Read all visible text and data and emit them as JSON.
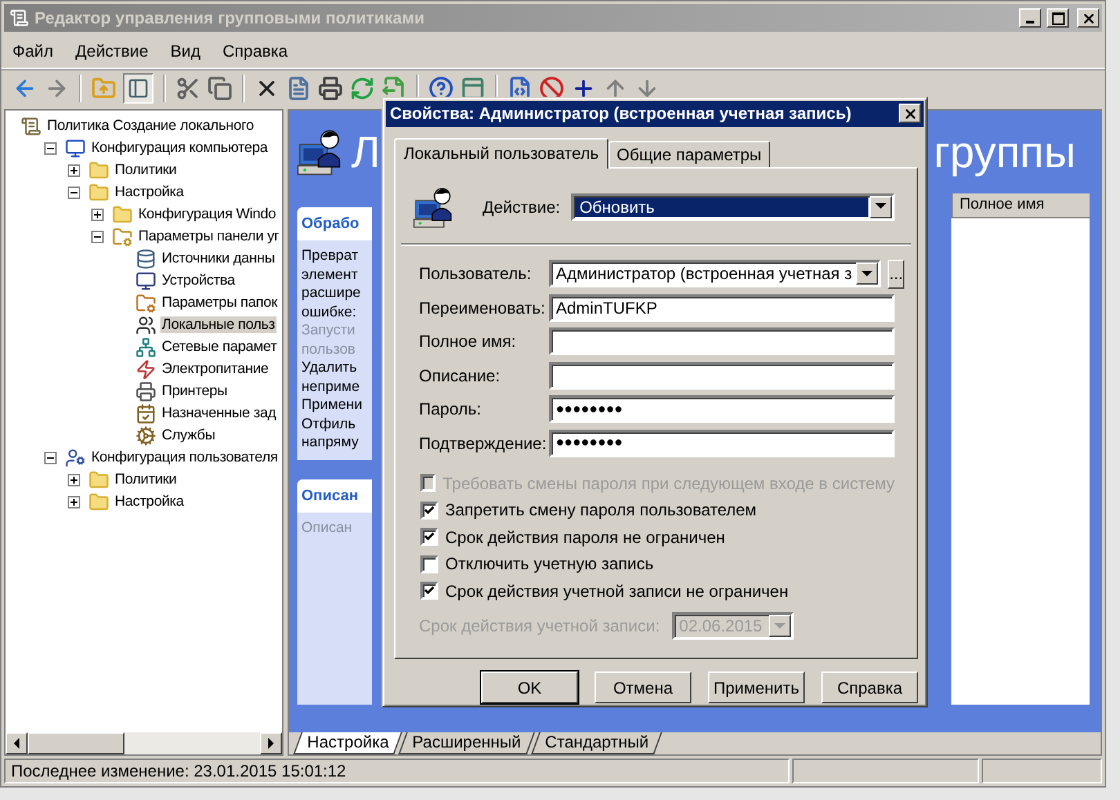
{
  "window": {
    "title": "Редактор управления групповыми политиками"
  },
  "menu": [
    "Файл",
    "Действие",
    "Вид",
    "Справка"
  ],
  "tree": [
    {
      "label": "Политика Создание локального",
      "kind": "policy",
      "selected": false,
      "children": [
        {
          "label": "Конфигурация компьютера",
          "kind": "computer",
          "selected": false,
          "expanded": true,
          "children": [
            {
              "label": "Политики",
              "kind": "folder",
              "selected": false,
              "expanded": false
            },
            {
              "label": "Настройка",
              "kind": "folder",
              "selected": false,
              "expanded": true,
              "children": [
                {
                  "label": "Конфигурация Windo",
                  "kind": "folder",
                  "selected": false,
                  "expanded": false
                },
                {
                  "label": "Параметры панели уг",
                  "kind": "control-panel",
                  "selected": false,
                  "expanded": true,
                  "children": [
                    {
                      "label": "Источники данны",
                      "kind": "datasource",
                      "selected": false
                    },
                    {
                      "label": "Устройства",
                      "kind": "device",
                      "selected": false
                    },
                    {
                      "label": "Параметры папок",
                      "kind": "folder-options",
                      "selected": false
                    },
                    {
                      "label": "Локальные польз",
                      "kind": "users",
                      "selected": true
                    },
                    {
                      "label": "Сетевые парамет",
                      "kind": "network",
                      "selected": false
                    },
                    {
                      "label": "Электропитание",
                      "kind": "power",
                      "selected": false
                    },
                    {
                      "label": "Принтеры",
                      "kind": "printer",
                      "selected": false
                    },
                    {
                      "label": "Назначенные зад",
                      "kind": "tasks",
                      "selected": false
                    },
                    {
                      "label": "Службы",
                      "kind": "services",
                      "selected": false
                    }
                  ]
                }
              ]
            }
          ]
        },
        {
          "label": "Конфигурация пользователя",
          "kind": "user-config",
          "selected": false,
          "expanded": true,
          "children": [
            {
              "label": "Политики",
              "kind": "folder",
              "selected": false,
              "expanded": false
            },
            {
              "label": "Настройка",
              "kind": "folder",
              "selected": false,
              "expanded": false
            }
          ]
        }
      ]
    }
  ],
  "content": {
    "heading_start": "Л",
    "heading_end": "группы",
    "cards": [
      {
        "title": "Обрабо",
        "lines": [
          {
            "text": "Преврат",
            "disabled": false
          },
          {
            "text": "элемент",
            "disabled": false
          },
          {
            "text": "расшире",
            "disabled": false
          },
          {
            "text": "ошибке:",
            "disabled": false
          },
          {
            "text": "Запусти",
            "disabled": true
          },
          {
            "text": "пользов",
            "disabled": true
          },
          {
            "text": "Удалить",
            "disabled": false
          },
          {
            "text": "неприме",
            "disabled": false
          },
          {
            "text": "Примени",
            "disabled": false
          },
          {
            "text": "Отфиль",
            "disabled": false
          },
          {
            "text": "напряму",
            "disabled": false
          }
        ]
      },
      {
        "title": "Описан",
        "lines": [
          {
            "text": "Описан",
            "disabled": true
          }
        ]
      }
    ],
    "list": {
      "columns": [
        "Полное имя"
      ]
    }
  },
  "view_tabs": [
    {
      "label": "Настройка",
      "selected": true
    },
    {
      "label": "Расширенный",
      "selected": false
    },
    {
      "label": "Стандартный",
      "selected": false
    }
  ],
  "status_bar": {
    "text": "Последнее изменение: 23.01.2015 15:01:12"
  },
  "dialog": {
    "title": "Свойства: Администратор (встроенная учетная запись)",
    "tabs": [
      {
        "label": "Локальный пользователь",
        "selected": true
      },
      {
        "label": "Общие параметры",
        "selected": false
      }
    ],
    "action": {
      "label": "Действие:",
      "value": "Обновить"
    },
    "fields": [
      {
        "label": "Пользователь:",
        "value": "Администратор (встроенная учетная з",
        "kind": "combo",
        "button": "..."
      },
      {
        "label": "Переименовать:",
        "value": "AdminTUFKP",
        "kind": "text"
      },
      {
        "label": "Полное имя:",
        "kind": "text"
      },
      {
        "label": "Описание:",
        "kind": "text"
      },
      {
        "label": "Пароль:",
        "value": "●●●●●●●●",
        "kind": "password"
      },
      {
        "label": "Подтверждение:",
        "value": "●●●●●●●●",
        "kind": "password"
      }
    ],
    "checkboxes": [
      {
        "label": "Требовать смены пароля при следующем входе в систему",
        "checked": false,
        "disabled": true
      },
      {
        "label": "Запретить смену пароля пользователем",
        "checked": true,
        "disabled": false
      },
      {
        "label": "Срок действия пароля не ограничен",
        "checked": true,
        "disabled": false
      },
      {
        "label": "Отключить учетную запись",
        "checked": false,
        "disabled": false
      },
      {
        "label": "Срок действия учетной записи не ограничен",
        "checked": true,
        "disabled": false
      }
    ],
    "expiry": {
      "label": "Срок действия учетной записи:",
      "value": "02.06.2015",
      "disabled": true
    },
    "buttons": [
      {
        "label": "OK",
        "default": true
      },
      {
        "label": "Отмена",
        "default": false
      },
      {
        "label": "Применить",
        "default": false
      },
      {
        "label": "Справка",
        "default": false
      }
    ]
  }
}
